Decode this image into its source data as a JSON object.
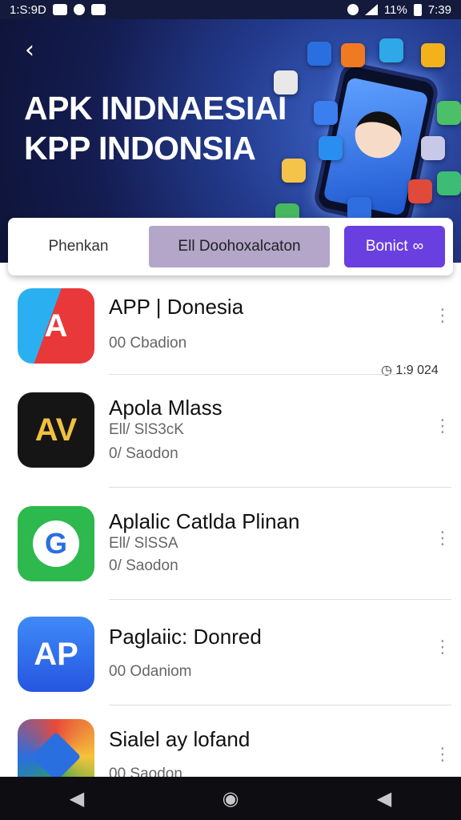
{
  "status_bar": {
    "time_left": "1:S:9D",
    "battery": "11%",
    "time_right": "7:39"
  },
  "hero": {
    "back_icon": "chevron-left-icon",
    "title_line1": "APK INDNAESIAI",
    "title_line2": "KPP INDONSIA"
  },
  "tabs": [
    {
      "label": "Phenkan",
      "selected": false
    },
    {
      "label": "Ell Doohoxalcaton",
      "selected": false
    },
    {
      "label": "Bonict",
      "selected": true
    }
  ],
  "apps": [
    {
      "name": "APP | Donesia",
      "line1": "00 Cbadion",
      "line2": "",
      "icon_text": "A",
      "icon_color": "#e8383a"
    },
    {
      "name": "Apola Mlass",
      "line1": "Ell/ SlS3cK",
      "line2": "0/ Saodon",
      "icon_text": "AV",
      "icon_color": "#151515"
    },
    {
      "name": "Aplalic Catlda Plinan",
      "line1": "Ell/ SlSSA",
      "line2": "0/ Saodon",
      "icon_text": "G",
      "icon_color": "#2db94d"
    },
    {
      "name": "Paglaiic: Donred",
      "line1": "00 Odaniom",
      "line2": "",
      "icon_text": "AP",
      "icon_color": "#2f6df0"
    },
    {
      "name": "Sialel ay lofand",
      "line1": "00 Saodon",
      "line2": "",
      "icon_text": "",
      "icon_color": "#2aa052"
    }
  ],
  "update_badge": "1:9 024",
  "nav": {
    "back": "◀",
    "home": "◉",
    "recents": "◀"
  },
  "colors": {
    "hero_bg": "#141c50",
    "accent": "#6a3fe0",
    "tab_muted": "#b3a6c9"
  }
}
